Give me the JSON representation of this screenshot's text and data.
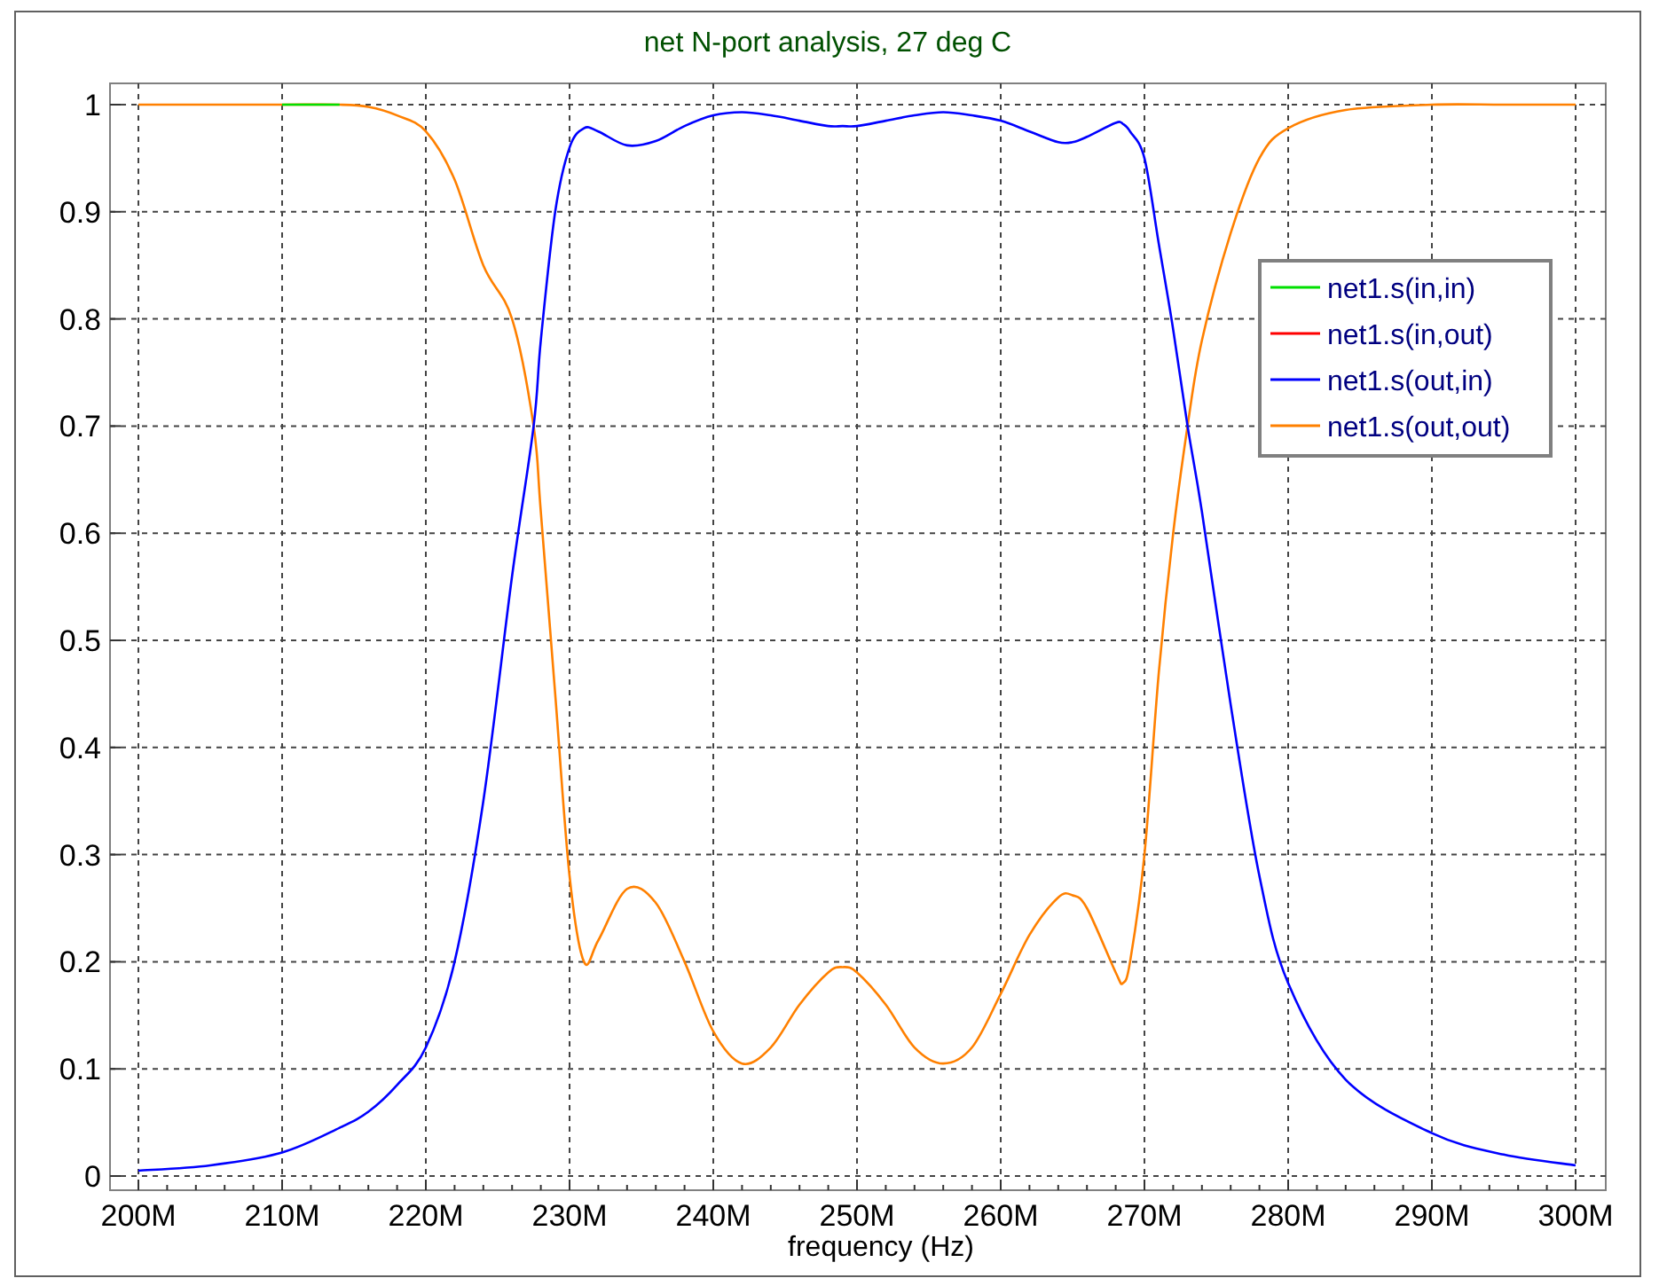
{
  "window": {
    "title": "net N-port analysis, 27 deg C"
  },
  "plot": {
    "chart_data": {
      "type": "line",
      "xlabel": "frequency (Hz)",
      "x": [
        200,
        205,
        210,
        214,
        216,
        218,
        220,
        222,
        224,
        226,
        227.5,
        228,
        229,
        230,
        231,
        232,
        234,
        236,
        238,
        240,
        242,
        244,
        246,
        248,
        249,
        250,
        252,
        254,
        256,
        258,
        260,
        262,
        264,
        265,
        266,
        268,
        268.5,
        269,
        270,
        271,
        272,
        273,
        274,
        276,
        278,
        280,
        284,
        290,
        295,
        300
      ],
      "xlim": [
        200,
        300
      ],
      "ylim": [
        0,
        1
      ],
      "grid": true,
      "legend": true,
      "xticks": [
        {
          "value": 200,
          "label": "200M"
        },
        {
          "value": 210,
          "label": "210M"
        },
        {
          "value": 220,
          "label": "220M"
        },
        {
          "value": 230,
          "label": "230M"
        },
        {
          "value": 240,
          "label": "240M"
        },
        {
          "value": 250,
          "label": "250M"
        },
        {
          "value": 260,
          "label": "260M"
        },
        {
          "value": 270,
          "label": "270M"
        },
        {
          "value": 280,
          "label": "280M"
        },
        {
          "value": 290,
          "label": "290M"
        },
        {
          "value": 300,
          "label": "300M"
        }
      ],
      "yticks": [
        {
          "value": 0,
          "label": "0"
        },
        {
          "value": 0.1,
          "label": "0.1"
        },
        {
          "value": 0.2,
          "label": "0.2"
        },
        {
          "value": 0.3,
          "label": "0.3"
        },
        {
          "value": 0.4,
          "label": "0.4"
        },
        {
          "value": 0.5,
          "label": "0.5"
        },
        {
          "value": 0.6,
          "label": "0.6"
        },
        {
          "value": 0.7,
          "label": "0.7"
        },
        {
          "value": 0.8,
          "label": "0.8"
        },
        {
          "value": 0.9,
          "label": "0.9"
        },
        {
          "value": 1,
          "label": "1"
        }
      ],
      "series": [
        {
          "name": "net1.s(in,in)",
          "color": "#00e000",
          "values": [
            null,
            null,
            1,
            1,
            null,
            null,
            null,
            null,
            null,
            null,
            null,
            null,
            null,
            null,
            null,
            null,
            null,
            null,
            null,
            null,
            null,
            null,
            null,
            null,
            null,
            null,
            null,
            null,
            null,
            null,
            null,
            null,
            null,
            null,
            null,
            null,
            null,
            null,
            null,
            null,
            null,
            null,
            null,
            null,
            null,
            null,
            null,
            null,
            null,
            null
          ]
        },
        {
          "name": "net1.s(in,out)",
          "color": "#ff0000",
          "values": [
            null,
            null,
            null,
            null,
            null,
            null,
            null,
            null,
            null,
            null,
            null,
            null,
            null,
            null,
            null,
            null,
            null,
            null,
            null,
            null,
            null,
            null,
            null,
            null,
            null,
            null,
            null,
            null,
            null,
            null,
            null,
            null,
            null,
            null,
            null,
            null,
            null,
            null,
            null,
            null,
            null,
            null,
            null,
            null,
            null,
            null,
            null,
            null,
            null,
            null
          ]
        },
        {
          "name": "net1.s(out,in)",
          "color": "#0000ff",
          "values": [
            0.005,
            0.01,
            0.022,
            0.045,
            0.06,
            0.085,
            0.12,
            0.2,
            0.35,
            0.56,
            0.7,
            0.78,
            0.9,
            0.96,
            0.978,
            0.975,
            0.962,
            0.966,
            0.98,
            0.99,
            0.993,
            0.99,
            0.985,
            0.98,
            0.98,
            0.98,
            0.985,
            0.99,
            0.993,
            0.99,
            0.985,
            0.975,
            0.965,
            0.965,
            0.97,
            0.983,
            0.982,
            0.975,
            0.95,
            0.87,
            0.79,
            0.7,
            0.62,
            0.44,
            0.28,
            0.18,
            0.09,
            0.04,
            0.02,
            0.01
          ]
        },
        {
          "name": "net1.s(out,out)",
          "color": "#ff8000",
          "values": [
            1,
            1,
            1,
            1,
            0.998,
            0.99,
            0.975,
            0.93,
            0.85,
            0.8,
            0.7,
            0.62,
            0.45,
            0.28,
            0.2,
            0.22,
            0.268,
            0.255,
            0.2,
            0.135,
            0.105,
            0.12,
            0.16,
            0.19,
            0.195,
            0.19,
            0.16,
            0.12,
            0.105,
            0.12,
            0.17,
            0.225,
            0.26,
            0.262,
            0.25,
            0.19,
            0.18,
            0.2,
            0.3,
            0.47,
            0.6,
            0.7,
            0.78,
            0.88,
            0.95,
            0.978,
            0.995,
            1,
            1,
            1
          ]
        }
      ]
    }
  }
}
